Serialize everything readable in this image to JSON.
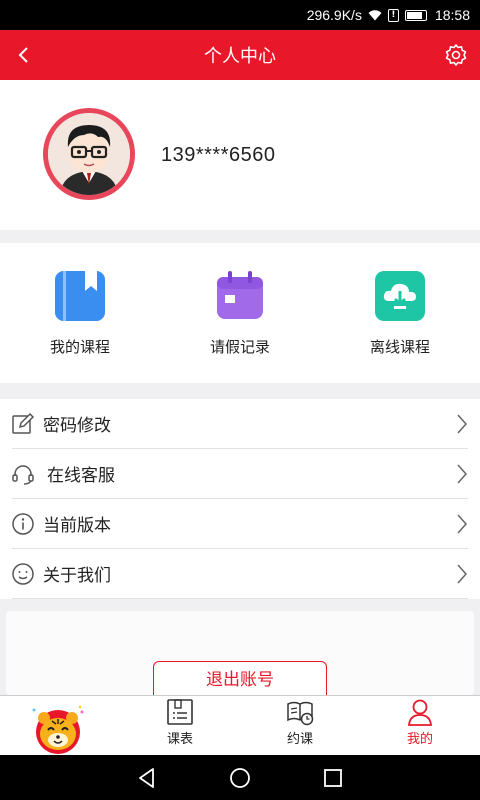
{
  "status_bar": {
    "speed": "296.9K/s",
    "time": "18:58",
    "icons": [
      "wifi-icon",
      "alert-icon",
      "battery-icon"
    ]
  },
  "app_bar": {
    "title": "个人中心",
    "back_icon": "chevron-left-icon",
    "settings_icon": "gear-icon"
  },
  "profile": {
    "phone": "139****6560",
    "avatar": "user-avatar"
  },
  "shortcuts": [
    {
      "label": "我的课程",
      "icon": "bookmark-book-icon",
      "color": "#3a8ef0"
    },
    {
      "label": "请假记录",
      "icon": "calendar-icon",
      "color": "#a06ae8"
    },
    {
      "label": "离线课程",
      "icon": "cloud-download-icon",
      "color": "#1ec6a6"
    }
  ],
  "menu": [
    {
      "label": "密码修改",
      "icon": "edit-icon"
    },
    {
      "label": "在线客服",
      "icon": "headset-icon"
    },
    {
      "label": "当前版本",
      "icon": "info-icon"
    },
    {
      "label": "关于我们",
      "icon": "smile-icon"
    }
  ],
  "logout": {
    "label": "退出账号"
  },
  "tabs": [
    {
      "label": "",
      "icon": "tiger-mascot-icon"
    },
    {
      "label": "课表",
      "icon": "schedule-icon"
    },
    {
      "label": "约课",
      "icon": "book-clock-icon"
    },
    {
      "label": "我的",
      "icon": "person-icon",
      "active": true
    }
  ],
  "colors": {
    "accent": "#e8182a"
  }
}
